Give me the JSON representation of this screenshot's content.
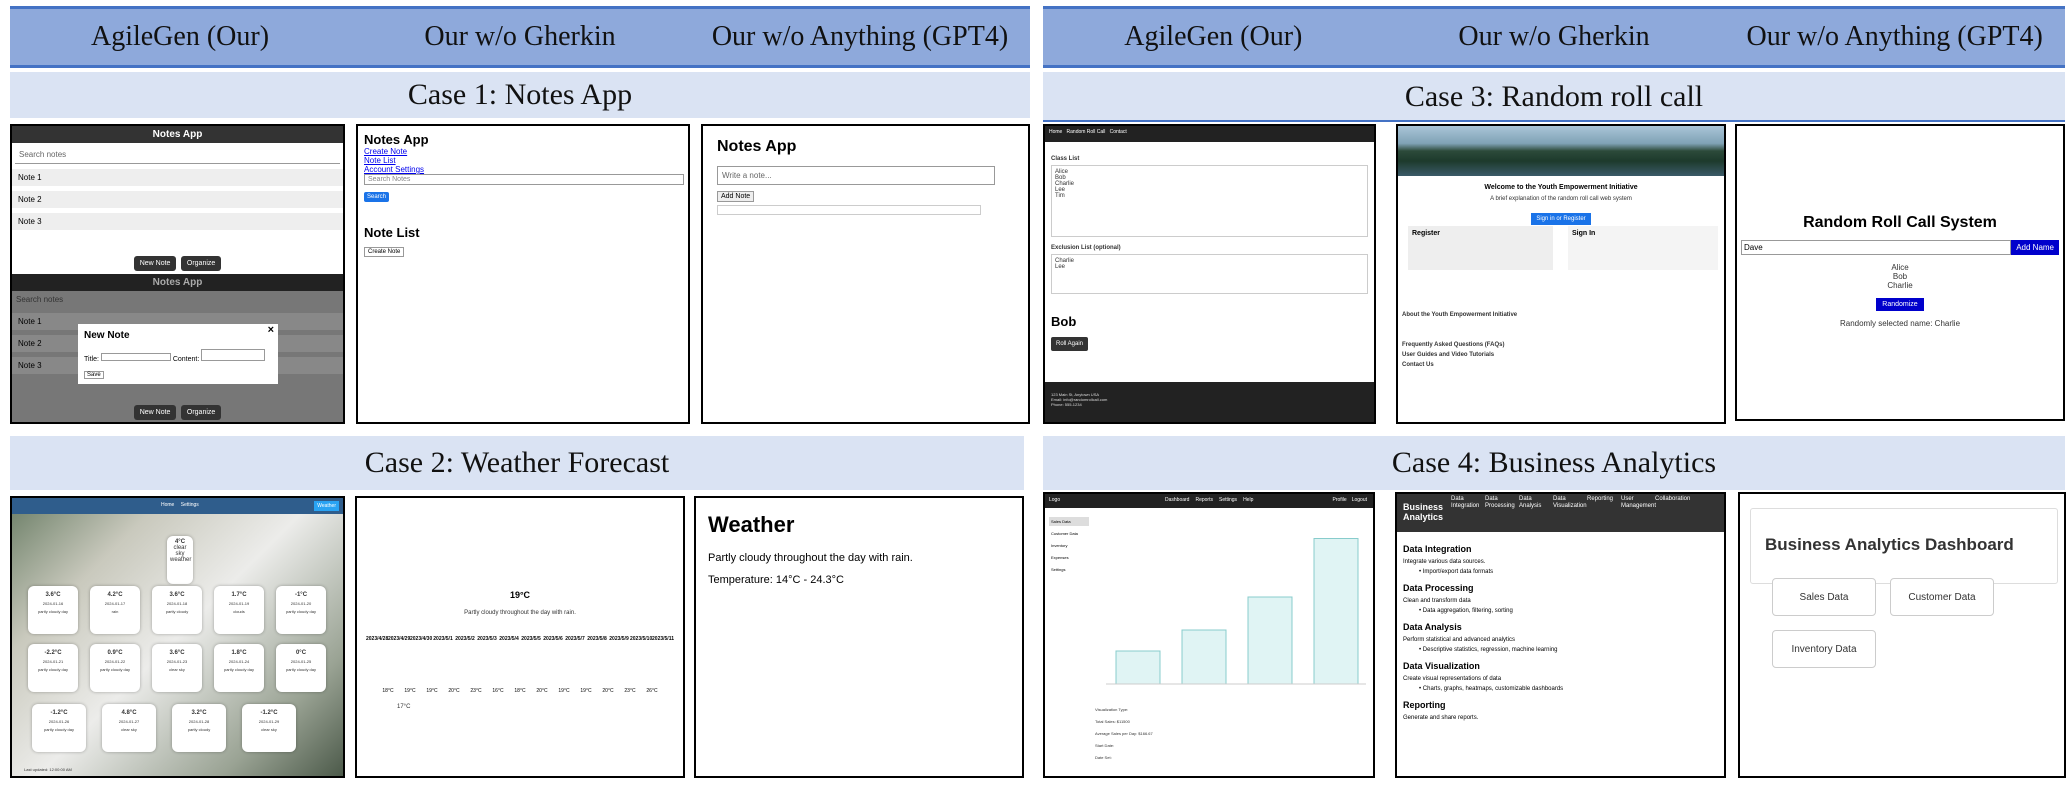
{
  "headers": {
    "col1": "AgileGen (Our)",
    "col2": "Our w/o Gherkin",
    "col3": "Our w/o Anything (GPT4)"
  },
  "cases": {
    "c1": "Case 1: Notes App",
    "c2": "Case 2: Weather Forecast",
    "c3": "Case 3: Random roll call",
    "c4": "Case 4: Business Analytics"
  },
  "notes_a": {
    "title": "Notes App",
    "search": "Search notes",
    "n1": "Note 1",
    "n2": "Note 2",
    "n3": "Note 3",
    "new_note": "New Note",
    "organize": "Organize",
    "modal_title": "New Note",
    "title_label": "Title:",
    "content_label": "Content:",
    "save": "Save",
    "close": "×"
  },
  "notes_b": {
    "title": "Notes App",
    "l1": "Create Note",
    "l2": "Note List",
    "l3": "Account Settings",
    "search": "Search Notes",
    "search_btn": "Search",
    "list_title": "Note List",
    "create_btn": "Create Note"
  },
  "notes_c": {
    "title": "Notes App",
    "placeholder": "Write a note...",
    "add": "Add Note"
  },
  "weather_a": {
    "nav1": "Home",
    "nav2": "Settings",
    "badge": "Weather",
    "top_temp": "4°C",
    "top_desc": "clear sky",
    "top_loc": "weather",
    "footer": "Last updated: 12:00:00 AM",
    "cards": [
      [
        "3.6°C",
        "2024-01-16",
        "partly cloudy day"
      ],
      [
        "4.2°C",
        "2024-01-17",
        "rain"
      ],
      [
        "3.6°C",
        "2024-01-18",
        "partly cloudy"
      ],
      [
        "1.7°C",
        "2024-01-19",
        "clouds"
      ],
      [
        "-1°C",
        "2024-01-20",
        "partly cloudy day"
      ],
      [
        "-2.2°C",
        "2024-01-21",
        "partly cloudy day"
      ],
      [
        "0.9°C",
        "2024-01-22",
        "partly cloudy day"
      ],
      [
        "3.6°C",
        "2024-01-23",
        "clear sky"
      ],
      [
        "1.8°C",
        "2024-01-24",
        "partly cloudy day"
      ],
      [
        "0°C",
        "2024-01-25",
        "partly cloudy day"
      ],
      [
        "-1.2°C",
        "2024-01-26",
        "partly cloudy day"
      ],
      [
        "4.8°C",
        "2024-01-27",
        "clear sky"
      ],
      [
        "3.2°C",
        "2024-01-28",
        "partly cloudy"
      ],
      [
        "-1.2°C",
        "2024-01-29",
        "clear sky"
      ]
    ]
  },
  "weather_b": {
    "temp": "19°C",
    "img_alt": "Partly cloudy throughout the day with rain.",
    "dates": [
      "2023/4/28",
      "2023/4/29",
      "2023/4/30",
      "2023/5/1",
      "2023/5/2",
      "2023/5/3",
      "2023/5/4",
      "2023/5/5",
      "2023/5/6",
      "2023/5/7",
      "2023/5/8",
      "2023/5/9",
      "2023/5/10",
      "2023/5/11"
    ],
    "temps": [
      "18°C",
      "19°C",
      "19°C",
      "20°C",
      "23°C",
      "16°C",
      "18°C",
      "20°C",
      "19°C",
      "19°C",
      "20°C",
      "23°C",
      "26°C"
    ],
    "extra": "17°C"
  },
  "weather_c": {
    "title": "Weather",
    "desc": "Partly cloudy throughout the day with rain.",
    "temp": "Temperature: 14°C - 24.3°C"
  },
  "roll_a": {
    "nav1": "Home",
    "nav2": "Random Roll Call",
    "nav3": "Contact",
    "class_list": "Class List",
    "names": "Alice\nBob\nCharlie\nLee\nTim",
    "excl": "Exclusion List (optional)",
    "excl_names": "Charlie\nLee",
    "result": "Bob",
    "btn": "Roll Again",
    "f1": "123 Main St, Anytown USA",
    "f2": "Email: info@randomrollcall.com",
    "f3": "Phone: 555-1234"
  },
  "roll_b": {
    "welcome": "Welcome to the Youth Empowerment Initiative",
    "sub": "A brief explanation of the random roll call web system",
    "signbtn": "Sign in or Register",
    "register": "Register",
    "signin": "Sign In",
    "about": "About the Youth Empowerment Initiative",
    "faq": "Frequently Asked Questions (FAQs)",
    "guides": "User Guides and Video Tutorials",
    "contact": "Contact Us"
  },
  "roll_c": {
    "title": "Random Roll Call System",
    "input": "Dave",
    "add": "Add Name",
    "n1": "Alice",
    "n2": "Bob",
    "n3": "Charlie",
    "rand": "Randomize",
    "sel": "Randomly selected name: Charlie"
  },
  "biz_a": {
    "logo": "Logo",
    "nav": [
      "Dashboard",
      "Reports",
      "Settings",
      "Help"
    ],
    "right": [
      "Profile",
      "Logout"
    ],
    "side": [
      "Sales Data",
      "Customer Data",
      "Inventory",
      "Expenses",
      "Settings"
    ],
    "bars": [
      0.22,
      0.36,
      0.58,
      0.97
    ],
    "f1": "Visualization Type:",
    "f2": "Total Sales: $11500",
    "f3": "Average Sales per Day: $166.67",
    "f4": "Start Date:",
    "f5": "Date Set:"
  },
  "biz_b": {
    "brand": "Business Analytics",
    "nav": [
      "Data Integration",
      "Data Processing",
      "Data Analysis",
      "Data Visualization",
      "Reporting",
      "User Management",
      "Collaboration"
    ],
    "sections": [
      [
        "Data Integration",
        "Integrate various data sources.",
        "Import/export data formats"
      ],
      [
        "Data Processing",
        "Clean and transform data",
        "Data aggregation, filtering, sorting"
      ],
      [
        "Data Analysis",
        "Perform statistical and advanced analytics",
        "Descriptive statistics, regression, machine learning"
      ],
      [
        "Data Visualization",
        "Create visual representations of data",
        "Charts, graphs, heatmaps, customizable dashboards"
      ],
      [
        "Reporting",
        "Generate and share reports.",
        ""
      ]
    ]
  },
  "biz_c": {
    "title": "Business Analytics Dashboard",
    "b1": "Sales Data",
    "b2": "Customer Data",
    "b3": "Inventory Data"
  }
}
